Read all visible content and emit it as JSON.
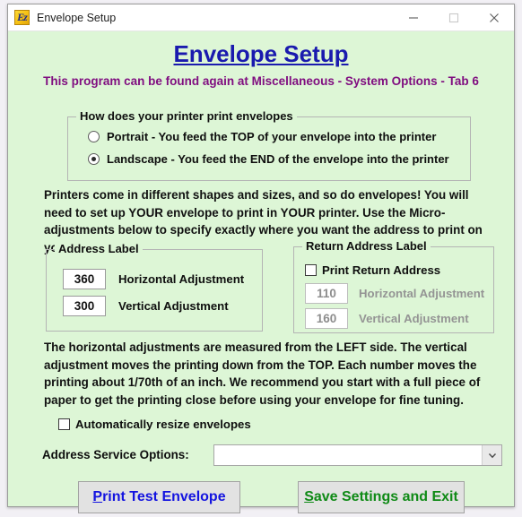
{
  "window": {
    "title": "Envelope Setup",
    "icon": "ez-app-icon",
    "icon_glyph": "Ez",
    "controls": {
      "minimize": "minimize-button",
      "maximize": "maximize-button",
      "close": "close-button"
    }
  },
  "header": {
    "title": "Envelope Setup",
    "subtitle": "This program can be found again at Miscellaneous - System Options - Tab 6",
    "title_color": "#1a1aae",
    "subtitle_color": "#800e80"
  },
  "orientation_group": {
    "legend": "How does your printer print envelopes",
    "options": [
      {
        "label": "Portrait - You feed the TOP of your envelope into the printer",
        "selected": false
      },
      {
        "label": "Landscape - You feed the END of the envelope into the printer",
        "selected": true
      }
    ]
  },
  "paragraphs": {
    "intro": "Printers come in different shapes and sizes, and so do envelopes!  You will need to set up YOUR envelope to print in YOUR printer.  Use the Micro-adjustments below to specify exactly where you want the address to print on your envelope.",
    "instructions": "The horizontal adjustments are measured from the LEFT side.  The vertical adjustment moves the printing down from the TOP.  Each number moves the printing about 1/70th of an inch.  We recommend you start with a full piece of paper to get the printing close before using your envelope for fine tuning."
  },
  "address_label_group": {
    "legend": "Address Label",
    "horizontal": {
      "value": "360",
      "label": "Horizontal Adjustment"
    },
    "vertical": {
      "value": "300",
      "label": "Vertical Adjustment"
    }
  },
  "return_address_group": {
    "legend": "Return Address Label",
    "print_return_address": {
      "label": "Print Return Address",
      "checked": false
    },
    "horizontal": {
      "value": "110",
      "label": "Horizontal Adjustment"
    },
    "vertical": {
      "value": "160",
      "label": "Vertical Adjustment"
    }
  },
  "auto_resize": {
    "label": "Automatically resize envelopes",
    "checked": false
  },
  "address_service": {
    "label": "Address Service Options:",
    "value": "",
    "placeholder": ""
  },
  "buttons": {
    "print_test": {
      "mnemonic": "P",
      "rest": "rint Test Envelope",
      "full": "Print Test Envelope",
      "color": "#1414e0"
    },
    "save_exit": {
      "mnemonic": "S",
      "rest": "ave Settings and Exit",
      "full": "Save Settings and Exit",
      "color": "#0f8a16"
    }
  }
}
